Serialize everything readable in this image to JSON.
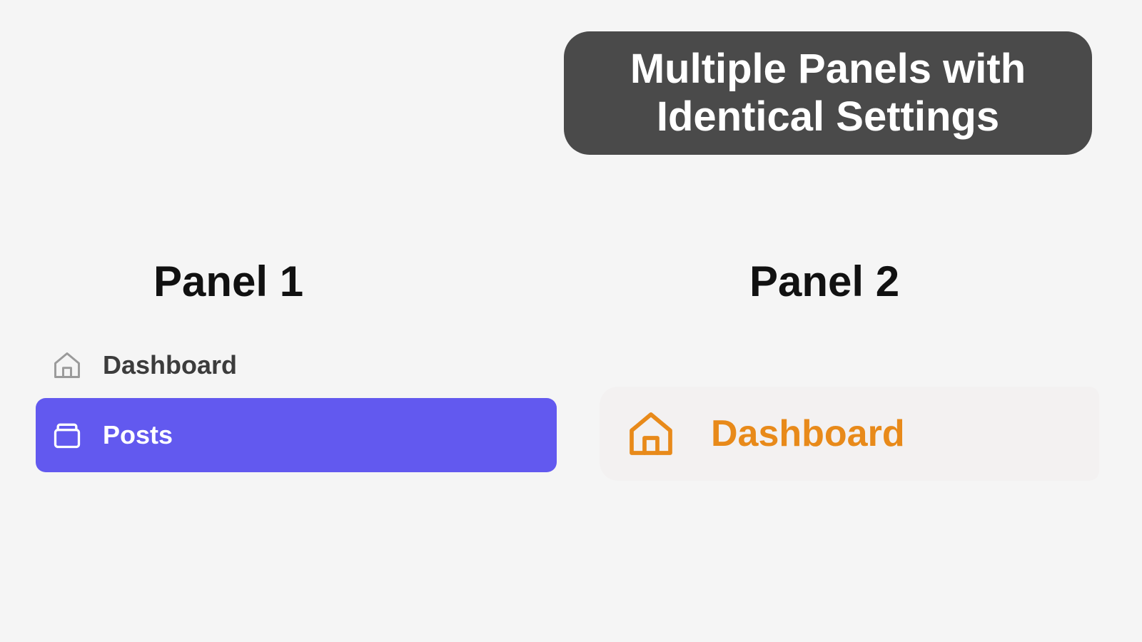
{
  "banner": {
    "title": "Multiple Panels with Identical Settings"
  },
  "panel1": {
    "heading": "Panel 1",
    "items": [
      {
        "label": "Dashboard"
      },
      {
        "label": "Posts"
      }
    ]
  },
  "panel2": {
    "heading": "Panel 2",
    "items": [
      {
        "label": "Dashboard"
      }
    ]
  },
  "colors": {
    "banner_bg": "#4a4a4a",
    "accent_purple": "#6259ef",
    "accent_orange": "#e88a1a"
  }
}
